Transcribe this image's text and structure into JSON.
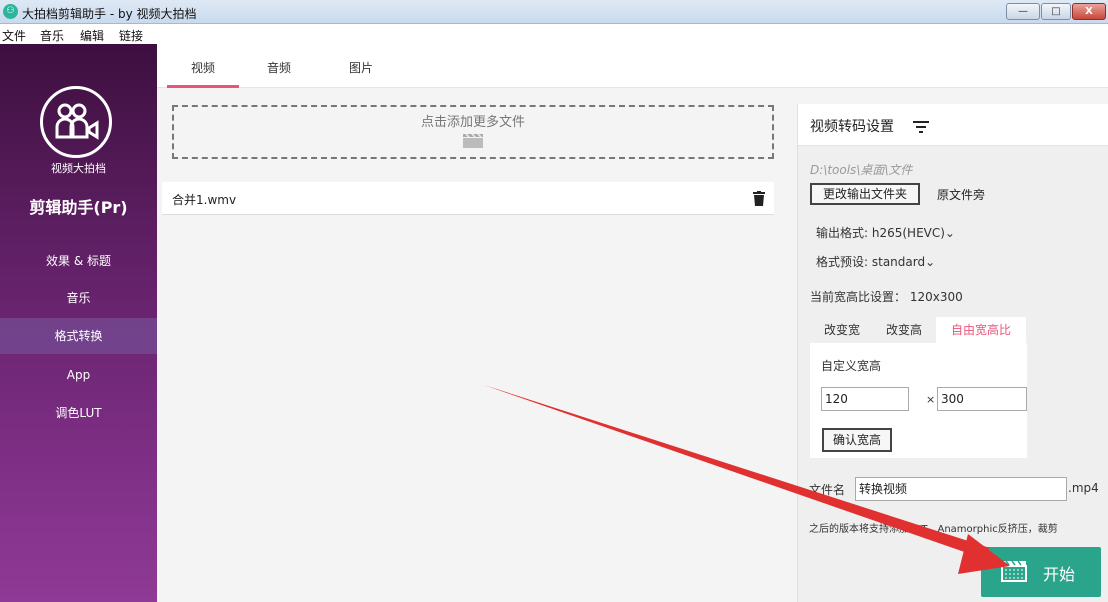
{
  "window": {
    "title": "大拍档剪辑助手 - by 视频大拍档",
    "app_icon_glyph": "⚇",
    "controls": {
      "minimize": "—",
      "maximize": "□",
      "close": "X"
    }
  },
  "menubar": {
    "items": [
      "文件",
      "音乐",
      "编辑",
      "链接"
    ]
  },
  "sidebar": {
    "brand_small": "视频大拍档",
    "brand_name": "剪辑助手(Pr)",
    "items": [
      "效果 & 标题",
      "音乐",
      "格式转换",
      "App",
      "调色LUT"
    ],
    "active_index": 2
  },
  "tabs": [
    "视频",
    "音频",
    "图片"
  ],
  "dropzone": {
    "label": "点击添加更多文件"
  },
  "files": [
    {
      "name": "合并1.wmv"
    }
  ],
  "panel": {
    "title": "视频转码设置",
    "output_path": "D:\\tools\\桌面\\文件",
    "change_output_button": "更改输出文件夹",
    "original_folder_option": "原文件旁",
    "output_format": "输出格式: h265(HEVC)⌄",
    "format_preset": "格式预设: standard⌄",
    "current_ratio": "当前宽高比设置： 120x300",
    "sub_tabs": [
      "改变宽",
      "改变高",
      "自由宽高比"
    ],
    "custom_size_label": "自定义宽高",
    "width_value": "120",
    "times_symbol": "×",
    "height_value": "300",
    "confirm_button": "确认宽高",
    "filename_label": "文件名",
    "filename_value": "转换视频",
    "extension": ".mp4",
    "note": "之后的版本将支持添加LUT，Anamorphic反挤压，裁剪",
    "start_button": "开始"
  },
  "colors": {
    "accent_pink": "#e8557a",
    "start_green": "#2aa58b",
    "sidebar_top": "#3d0f3f",
    "sidebar_bottom": "#8f3a96",
    "annotation_red": "#e03030"
  },
  "icons": {
    "app": "app-logo-icon",
    "logo": "users-camera-icon",
    "dropzone": "clapperboard-icon",
    "delete": "trash-icon",
    "panel_menu": "filter-icon",
    "start": "film-icon"
  }
}
